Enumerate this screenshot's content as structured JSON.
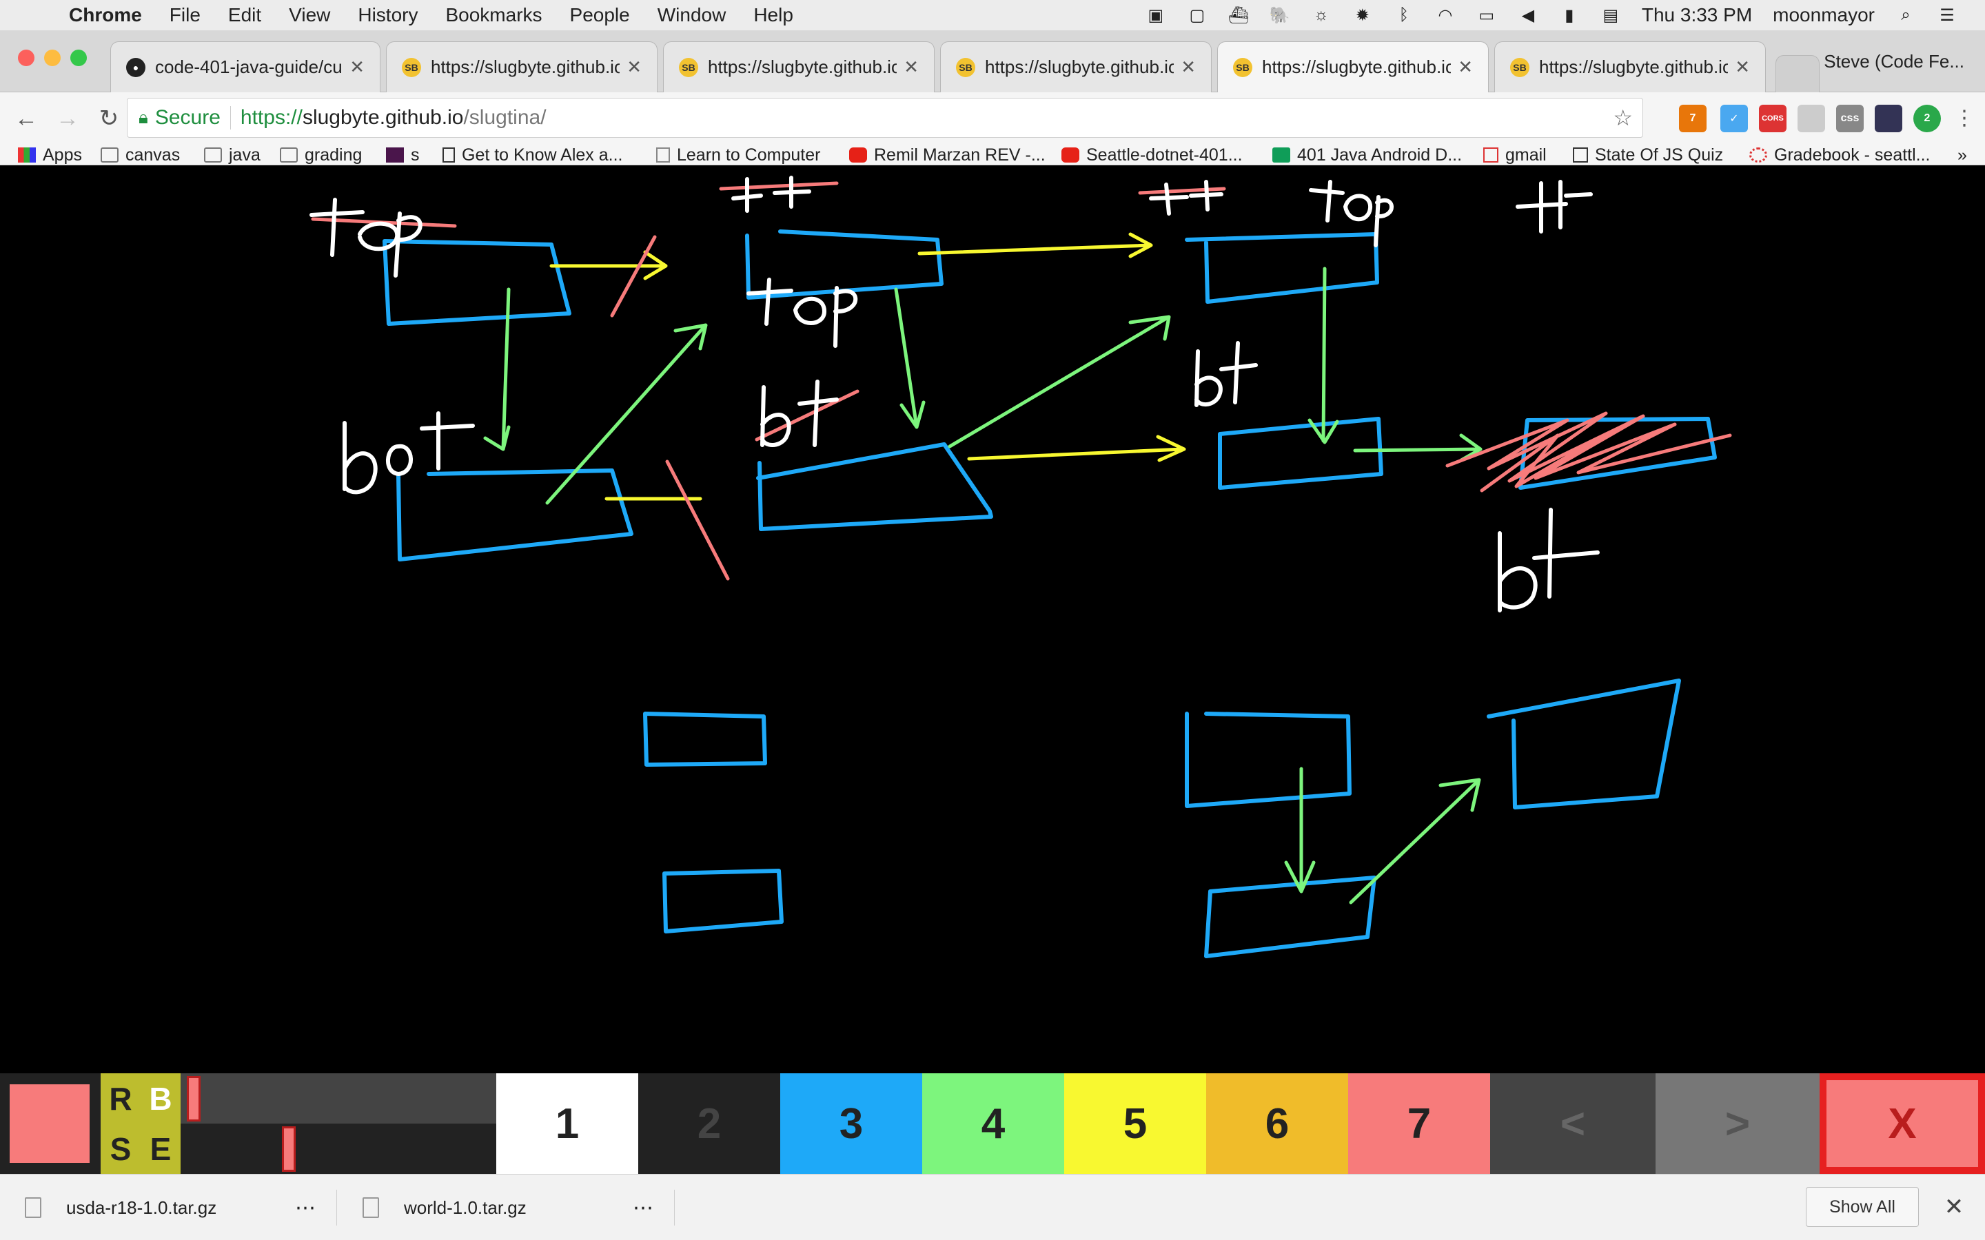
{
  "menubar": {
    "app": "Chrome",
    "items": [
      "File",
      "Edit",
      "View",
      "History",
      "Bookmarks",
      "People",
      "Window",
      "Help"
    ],
    "clock": "Thu 3:33 PM",
    "user": "moonmayor",
    "icons": [
      "screen-mirror-icon",
      "square-icon",
      "docker-icon",
      "evernote-icon",
      "brightness-icon",
      "sun-icon",
      "bluetooth-icon",
      "wifi-icon",
      "airplay-icon",
      "volume-icon",
      "battery-icon",
      "flag-us-icon",
      "spotlight-icon",
      "notification-list-icon"
    ]
  },
  "tabs": [
    {
      "title": "code-401-java-guide/curr",
      "icon": "github-icon",
      "active": false
    },
    {
      "title": "https://slugbyte.github.io/",
      "icon": "slugbyte-icon",
      "active": false
    },
    {
      "title": "https://slugbyte.github.io/",
      "icon": "slugbyte-icon",
      "active": false
    },
    {
      "title": "https://slugbyte.github.io/",
      "icon": "slugbyte-icon",
      "active": false
    },
    {
      "title": "https://slugbyte.github.io/",
      "icon": "slugbyte-icon",
      "active": true
    },
    {
      "title": "https://slugbyte.github.io/",
      "icon": "slugbyte-icon",
      "active": false
    }
  ],
  "tab_icon_glyph": "SB",
  "profile": "Steve (Code Fe...",
  "omnibox": {
    "secure_label": "Secure",
    "scheme": "https://",
    "host": "slugbyte.github.io",
    "path": "/slugtina/"
  },
  "extensions": [
    {
      "name": "ext-badge-icon",
      "label": "7",
      "color": "#e8760a"
    },
    {
      "name": "ext-check-icon",
      "label": "✓",
      "color": "#4aa8f0"
    },
    {
      "name": "ext-cors-icon",
      "label": "CORS",
      "color": "#d33"
    },
    {
      "name": "ext-grid-icon",
      "label": "",
      "color": "#ccc"
    },
    {
      "name": "ext-css-icon",
      "label": "css",
      "color": "#888"
    },
    {
      "name": "ext-phone-icon",
      "label": "",
      "color": "#335"
    },
    {
      "name": "ext-green-icon",
      "label": "2",
      "color": "#2aa84a"
    }
  ],
  "bookmarks": [
    {
      "label": "Apps",
      "icon": "apps-grid-icon"
    },
    {
      "label": "canvas",
      "icon": "folder-icon"
    },
    {
      "label": "java",
      "icon": "folder-icon"
    },
    {
      "label": "grading",
      "icon": "folder-icon"
    },
    {
      "label": "s",
      "icon": "slack-icon"
    },
    {
      "label": "Get to Know Alex a...",
      "icon": "medium-icon"
    },
    {
      "label": "Learn to Computer",
      "icon": "page-icon"
    },
    {
      "label": "Remil Marzan REV -...",
      "icon": "youtube-icon"
    },
    {
      "label": "Seattle-dotnet-401...",
      "icon": "youtube-icon"
    },
    {
      "label": "401 Java Android D...",
      "icon": "sheets-icon"
    },
    {
      "label": "gmail",
      "icon": "gmail-icon"
    },
    {
      "label": "State Of JS Quiz",
      "icon": "t-icon"
    },
    {
      "label": "Gradebook - seattl...",
      "icon": "canvas-icon"
    }
  ],
  "canvas_labels": [
    {
      "text": "top",
      "color": "#ffffff"
    },
    {
      "text": "++",
      "color": "#ffffff"
    },
    {
      "text": "top",
      "color": "#ffffff"
    },
    {
      "text": "bot",
      "color": "#ffffff"
    },
    {
      "text": "bt",
      "color": "#ffffff"
    },
    {
      "text": "++",
      "color": "#ffffff"
    },
    {
      "text": "top",
      "color": "#ffffff"
    },
    {
      "text": "bt",
      "color": "#ffffff"
    },
    {
      "text": "++",
      "color": "#ffffff"
    },
    {
      "text": "bt",
      "color": "#ffffff"
    }
  ],
  "palette": {
    "brush_color": "#f77b7b",
    "rbse": [
      "R",
      "B",
      "S",
      "E"
    ],
    "slider_top": 0.02,
    "slider_bottom": 0.34,
    "colors": [
      {
        "label": "1",
        "bg": "#ffffff",
        "fg": "#222222"
      },
      {
        "label": "2",
        "bg": "#222222",
        "fg": "#444444"
      },
      {
        "label": "3",
        "bg": "#1ea9f8",
        "fg": "#222222"
      },
      {
        "label": "4",
        "bg": "#7df57d",
        "fg": "#222222"
      },
      {
        "label": "5",
        "bg": "#f8f830",
        "fg": "#222222"
      },
      {
        "label": "6",
        "bg": "#f0bc2a",
        "fg": "#222222"
      },
      {
        "label": "7",
        "bg": "#f77b7b",
        "fg": "#222222"
      }
    ],
    "prev_label": "<",
    "next_label": ">",
    "close_label": "X"
  },
  "downloads": [
    {
      "name": "usda-r18-1.0.tar.gz"
    },
    {
      "name": "world-1.0.tar.gz"
    }
  ],
  "downloads_show_all": "Show All",
  "downloads_close": "✕"
}
